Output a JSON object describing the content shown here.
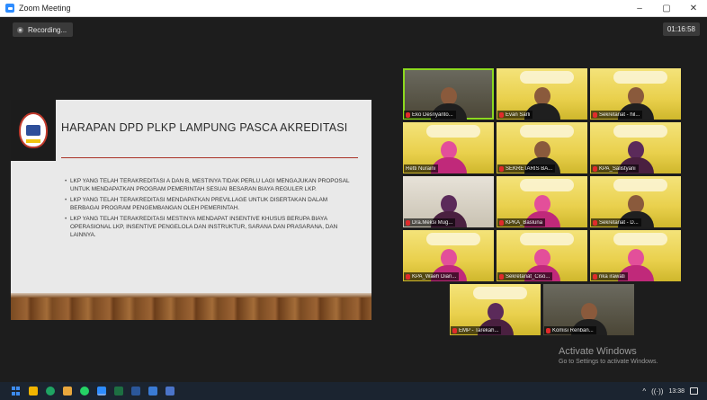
{
  "window": {
    "title": "Zoom Meeting",
    "minimize_glyph": "–",
    "maximize_glyph": "▢",
    "close_glyph": "✕"
  },
  "meeting": {
    "recording_label": "Recording...",
    "timer": "01:16:58"
  },
  "slide": {
    "title": "HARAPAN DPD PLKP LAMPUNG PASCA AKREDITASI",
    "bullets": [
      "LKP YANG TELAH TERAKREDITASI A DAN B, MESTINYA TIDAK PERLU LAGI MENGAJUKAN PROPOSAL UNTUK MENDAPATKAN PROGRAM PEMERINTAH SESUAI BESARAN BIAYA REGULER LKP.",
      "LKP YANG TELAH TERAKREDITASI MENDAPATKAN PREVILLAGE UNTUK DISERTAKAN DALAM BERBAGAI PROGRAM PENGEMBANGAN OLEH PEMERINTAH.",
      "LKP YANG TELAH TERAKREDITASI MESTINYA MENDAPAT INSENTIVE KHUSUS BERUPA BIAYA OPERASIONAL LKP, INSENTIVE PENGELOLA DAN INSTRUKTUR, SARANA DAN PRASARANA, DAN LAINNYA."
    ]
  },
  "participants": [
    {
      "name": "Eko Desriyanto..."
    },
    {
      "name": "Evan Sarli"
    },
    {
      "name": "Sekretariat - hil..."
    },
    {
      "name": "Retti Nuraini"
    },
    {
      "name": "SEKRETARIS BA..."
    },
    {
      "name": "KPA_Salistyani"
    },
    {
      "name": "Dra.Meksi Mug..."
    },
    {
      "name": "KPKA_Basluna"
    },
    {
      "name": "Sekretariat - D..."
    },
    {
      "name": "KPA_Waeh Dian..."
    },
    {
      "name": "Sekretariat_Ciso..."
    },
    {
      "name": "rika irawati"
    },
    {
      "name": "EMP - Tarekah..."
    },
    {
      "name": "Komisi Renban..."
    }
  ],
  "watermark": {
    "line1": "Activate Windows",
    "line2": "Go to Settings to activate Windows."
  },
  "taskbar": {
    "time": "13:38",
    "tray_up": "^",
    "wifi": "((·))"
  },
  "colors": {
    "active_speaker": "#8cd91f",
    "zoom_blue": "#2d8cff",
    "tile_yellow": "#e9d04c"
  }
}
